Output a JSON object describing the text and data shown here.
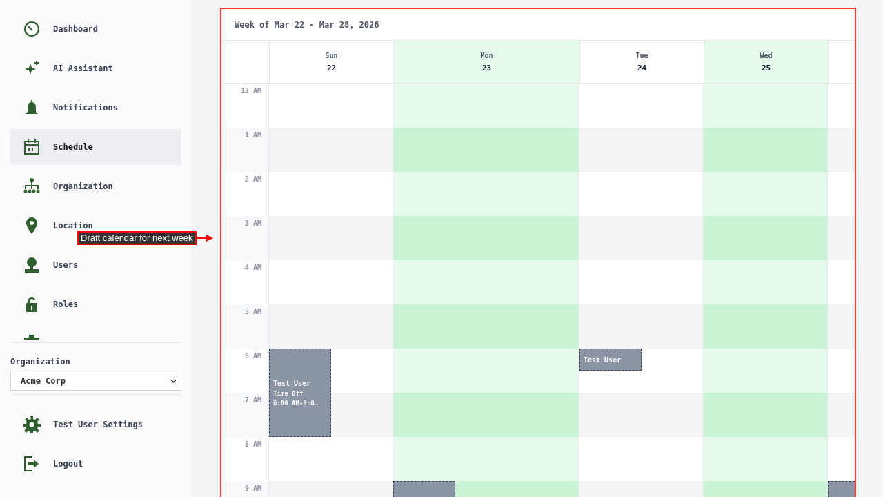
{
  "sidebar": {
    "items": [
      {
        "label": "Dashboard",
        "selected": false
      },
      {
        "label": "AI Assistant",
        "selected": false
      },
      {
        "label": "Notifications",
        "selected": false
      },
      {
        "label": "Schedule",
        "selected": true
      },
      {
        "label": "Organization",
        "selected": false
      },
      {
        "label": "Location",
        "selected": false
      },
      {
        "label": "Users",
        "selected": false
      },
      {
        "label": "Roles",
        "selected": false
      },
      {
        "selected": false
      }
    ],
    "org_label": "Organization",
    "org_value": "Acme Corp",
    "footer": [
      {
        "label": "Test User Settings"
      },
      {
        "label": "Logout"
      }
    ]
  },
  "calendar": {
    "title": "Week of Mar 22 - Mar 28, 2026",
    "days": [
      {
        "name": "Sun",
        "date": "22",
        "available": false
      },
      {
        "name": "Mon",
        "date": "23",
        "available": true
      },
      {
        "name": "Tue",
        "date": "24",
        "available": false
      },
      {
        "name": "Wed",
        "date": "25",
        "available": true
      },
      {
        "available": false
      }
    ],
    "rows": [
      {
        "label": "12 AM",
        "cells": [
          {
            "available": false
          },
          {
            "available": true
          },
          {
            "available": false
          },
          {
            "available": true
          },
          {
            "available": false
          }
        ]
      },
      {
        "label": "1 AM",
        "cells": [
          {
            "available": false
          },
          {
            "available": true
          },
          {
            "available": false
          },
          {
            "available": true
          },
          {
            "available": false
          }
        ]
      },
      {
        "label": "2 AM",
        "cells": [
          {
            "available": false
          },
          {
            "available": true
          },
          {
            "available": false
          },
          {
            "available": true
          },
          {
            "available": false
          }
        ]
      },
      {
        "label": "3 AM",
        "cells": [
          {
            "available": false
          },
          {
            "available": true
          },
          {
            "available": false
          },
          {
            "available": true
          },
          {
            "available": false
          }
        ]
      },
      {
        "label": "4 AM",
        "cells": [
          {
            "available": false
          },
          {
            "available": true
          },
          {
            "available": false
          },
          {
            "available": true
          },
          {
            "available": false
          }
        ]
      },
      {
        "label": "5 AM",
        "cells": [
          {
            "available": false
          },
          {
            "available": true
          },
          {
            "available": false
          },
          {
            "available": true
          },
          {
            "available": false
          }
        ]
      },
      {
        "label": "6 AM",
        "cells": [
          {
            "available": false,
            "events": [
              {
                "kind": "long",
                "lines": [
                  "Test User",
                  "Time Off",
                  "6:00 AM-8:0…"
                ]
              }
            ]
          },
          {
            "available": true
          },
          {
            "available": false,
            "events": [
              {
                "kind": "short",
                "lines": [
                  "Test User"
                ]
              }
            ]
          },
          {
            "available": true
          },
          {
            "available": false
          }
        ]
      },
      {
        "label": "7 AM",
        "cells": [
          {
            "available": false
          },
          {
            "available": true
          },
          {
            "available": false
          },
          {
            "available": true
          },
          {
            "available": false
          }
        ]
      },
      {
        "label": "8 AM",
        "cells": [
          {
            "available": false
          },
          {
            "available": true
          },
          {
            "available": false
          },
          {
            "available": true
          },
          {
            "available": false
          }
        ]
      },
      {
        "label": "9 AM",
        "cells": [
          {
            "available": false
          },
          {
            "available": true,
            "events": [
              {
                "kind": "open"
              }
            ]
          },
          {
            "available": false
          },
          {
            "available": true
          },
          {
            "events": [
              {
                "kind": "open"
              }
            ]
          }
        ]
      }
    ]
  },
  "annotation": {
    "text": "Draft calendar for next week"
  }
}
